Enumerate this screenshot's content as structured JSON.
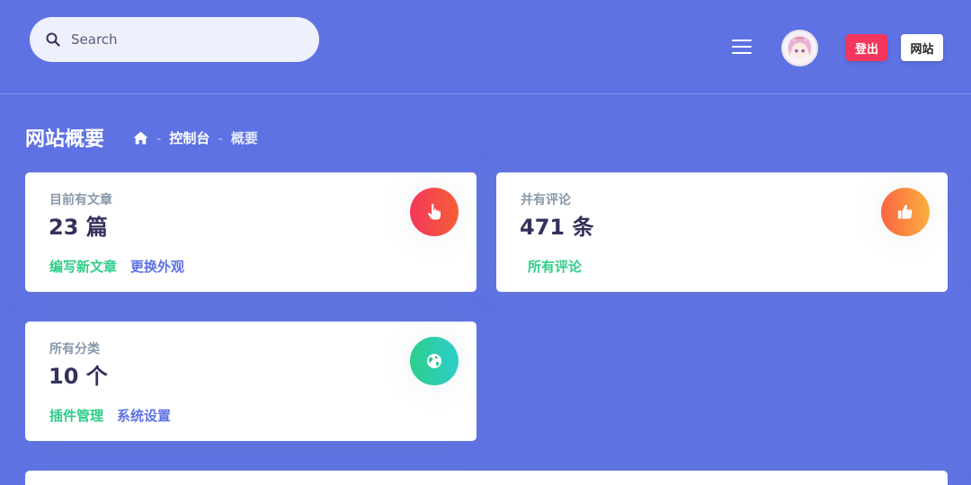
{
  "search": {
    "placeholder": "Search"
  },
  "header_buttons": {
    "logout": "登出",
    "site": "网站"
  },
  "page": {
    "title": "网站概要",
    "breadcrumb": [
      "控制台",
      "概要"
    ],
    "separator": "-"
  },
  "cards": [
    {
      "label": "目前有文章",
      "value": "23 篇",
      "links": [
        "编写新文章",
        "更换外观"
      ],
      "icon": "hand-pointer-icon",
      "color": "#f5365c"
    },
    {
      "label": "并有评论",
      "value": "471 条",
      "links": [
        "所有评论"
      ],
      "icon": "thumbs-up-icon",
      "color": "#fb6340"
    },
    {
      "label": "所有分类",
      "value": "10 个",
      "links": [
        "插件管理",
        "系统设置"
      ],
      "icon": "globe-icon",
      "color": "#2dce89"
    }
  ],
  "colors": {
    "background": "#5e72e4",
    "link_green": "#2dce89",
    "link_blue": "#5e72e4",
    "danger": "#f5365c"
  }
}
